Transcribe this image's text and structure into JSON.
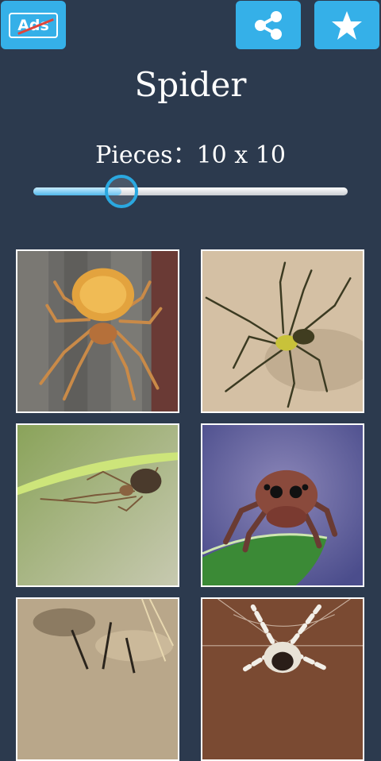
{
  "toolbar": {
    "ads_label": "Ads",
    "share_icon": "share-icon",
    "favorite_icon": "star-icon"
  },
  "title": "Spider",
  "pieces": {
    "label": "Pieces：10 x 10",
    "slider_fraction": 0.28
  },
  "puzzles": [
    {
      "name": "orange-spider-on-wood"
    },
    {
      "name": "long-legged-spider-on-sand"
    },
    {
      "name": "spider-on-grass-blade"
    },
    {
      "name": "jumping-spider-on-leaf"
    },
    {
      "name": "spider-on-dry-ground"
    },
    {
      "name": "spider-on-web"
    }
  ],
  "colors": {
    "background": "#2c3a4e",
    "accent": "#35b0e8"
  }
}
